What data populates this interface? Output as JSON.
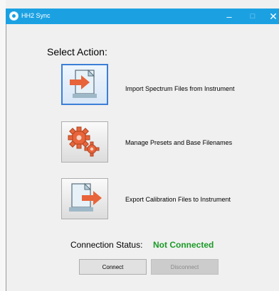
{
  "window": {
    "title": "HH2 Sync",
    "controls": {
      "minimize": "–",
      "maximize": "□",
      "close": "✕"
    }
  },
  "main": {
    "heading": "Select Action:",
    "actions": [
      {
        "label": "Import Spectrum Files from Instrument",
        "icon": "import-file-icon",
        "selected": true
      },
      {
        "label": "Manage Presets and Base Filenames",
        "icon": "gears-icon",
        "selected": false
      },
      {
        "label": "Export Calibration Files to Instrument",
        "icon": "export-file-icon",
        "selected": false
      }
    ]
  },
  "status": {
    "label": "Connection Status:",
    "value": "Not Connected",
    "value_color": "#1a9a26"
  },
  "buttons": {
    "connect_label": "Connect",
    "disconnect_label": "Disconnect",
    "disconnect_enabled": false
  },
  "colors": {
    "titlebar": "#1ba1e2",
    "selected_border": "#3c7fd6",
    "arrow": "#e8643a"
  }
}
